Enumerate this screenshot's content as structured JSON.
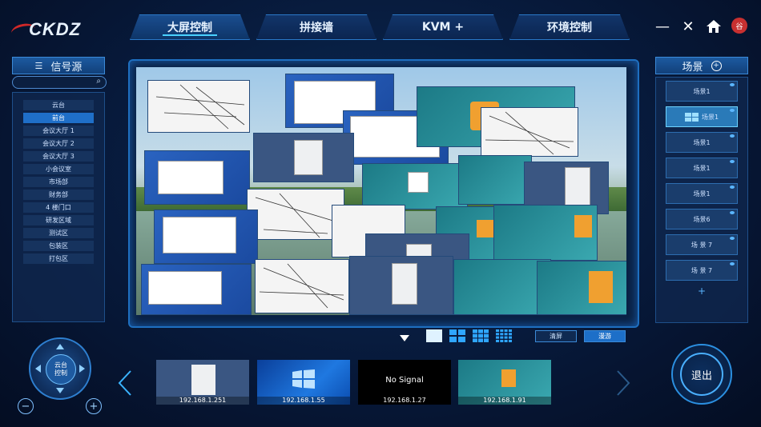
{
  "brand": {
    "logo_text": "CKDZ"
  },
  "tabs": [
    {
      "label": "大屏控制",
      "active": true
    },
    {
      "label": "拼接墙",
      "active": false
    },
    {
      "label": "KVM +",
      "active": false
    },
    {
      "label": "环境控制",
      "active": false
    }
  ],
  "window_controls": {
    "minimize": "—",
    "close": "✕",
    "avatar": "谷"
  },
  "source_panel": {
    "title": "信号源",
    "search_placeholder": "",
    "items": [
      "云台",
      "前台",
      "会议大厅 1",
      "会议大厅 2",
      "会议大厅 3",
      "小会议室",
      "市场部",
      "财务部",
      "4 楼门口",
      "研发区域",
      "测试区",
      "包装区",
      "打包区"
    ],
    "active_index": 1
  },
  "scene_panel": {
    "title": "场景",
    "add_icon": "+",
    "items": [
      "场景1",
      "场景1",
      "场景1",
      "场景1",
      "场景1",
      "场景6",
      "场 景 7",
      "场 景 7"
    ],
    "active_index": 1,
    "add_more": "+"
  },
  "layout_controls": {
    "dropdown_icon": "chevron-down-icon",
    "layouts": [
      "1x1",
      "2x2",
      "3x3",
      "4x4"
    ],
    "clear_label": "清屏",
    "roam_label": "漫游"
  },
  "thumbnails": [
    {
      "label": "192.168.1.251",
      "kind": "desktop-gray"
    },
    {
      "label": "192.168.1.55",
      "kind": "desktop-blue"
    },
    {
      "label": "192.168.1.27",
      "kind": "no-signal",
      "center_text": "No Signal"
    },
    {
      "label": "192.168.1.91",
      "kind": "desktop-teal"
    }
  ],
  "ptz": {
    "line1": "云台",
    "line2": "控制"
  },
  "exit_label": "退出",
  "colors": {
    "accent": "#4ad2ff",
    "brand_red": "#d02828",
    "active_blue": "#1f6fc8"
  }
}
